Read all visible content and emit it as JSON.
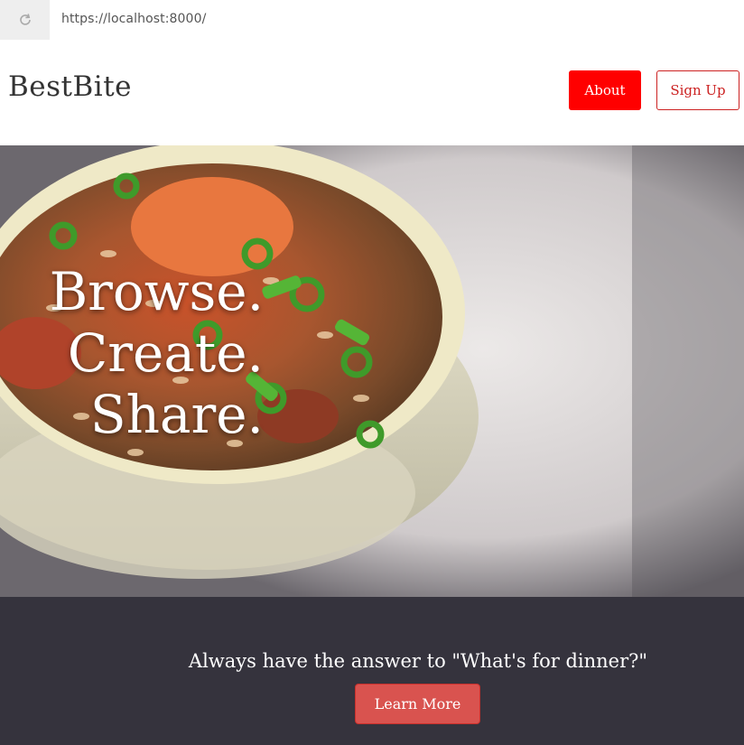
{
  "browser": {
    "url": "https://localhost:8000/",
    "reload_icon": "reload-icon"
  },
  "header": {
    "logo": "BestBite",
    "about_label": "About",
    "signup_label": "Sign Up",
    "colors": {
      "about_bg": "#ff0000",
      "signup_border": "#cc2222"
    }
  },
  "hero": {
    "lines": [
      "Browse.",
      "Create.",
      "Share."
    ],
    "image": "bowl-of-jambalaya-photo"
  },
  "cta": {
    "text": "Always have the answer to \"What's for dinner?\"",
    "button_label": "Learn More",
    "colors": {
      "band_bg": "#35333d",
      "button_bg": "#d9534f"
    }
  }
}
